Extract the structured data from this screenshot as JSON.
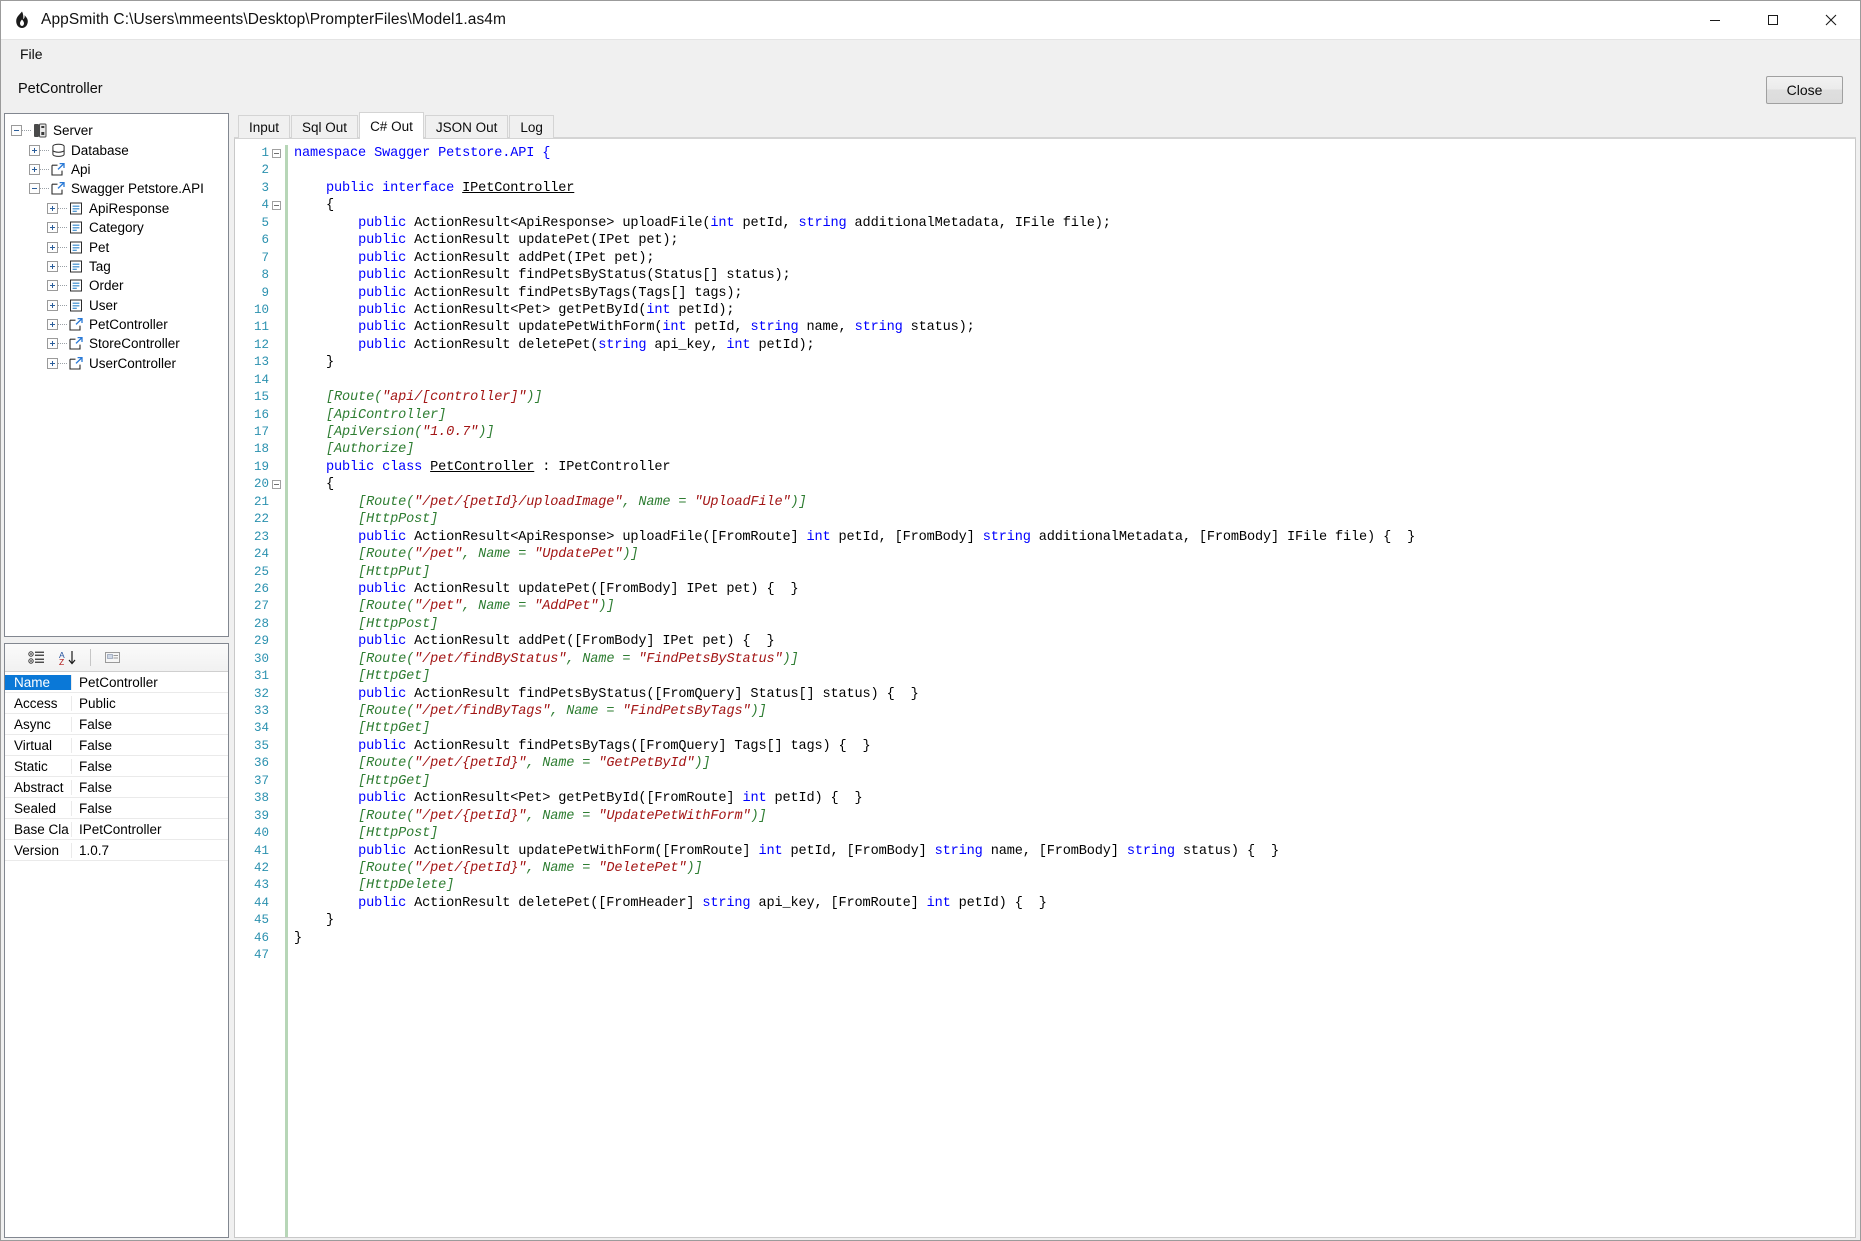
{
  "window": {
    "title": "AppSmith C:\\Users\\mmeents\\Desktop\\PrompterFiles\\Model1.as4m",
    "app_icon": "flame-icon",
    "minimize_label": "—",
    "maximize_label": "□",
    "close_label": "✕"
  },
  "menubar": {
    "items": [
      {
        "label": "File"
      }
    ]
  },
  "subheader": {
    "breadcrumb": "PetController",
    "close_button": "Close"
  },
  "tree": {
    "nodes": [
      {
        "label": "Server",
        "depth": 0,
        "expander": "minus",
        "icon": "server-icon"
      },
      {
        "label": "Database",
        "depth": 1,
        "expander": "plus",
        "icon": "database-icon"
      },
      {
        "label": "Api",
        "depth": 1,
        "expander": "plus",
        "icon": "api-icon"
      },
      {
        "label": "Swagger Petstore.API",
        "depth": 1,
        "expander": "minus",
        "icon": "api-icon"
      },
      {
        "label": "ApiResponse",
        "depth": 2,
        "expander": "plus",
        "icon": "class-icon"
      },
      {
        "label": "Category",
        "depth": 2,
        "expander": "plus",
        "icon": "class-icon"
      },
      {
        "label": "Pet",
        "depth": 2,
        "expander": "plus",
        "icon": "class-icon"
      },
      {
        "label": "Tag",
        "depth": 2,
        "expander": "plus",
        "icon": "class-icon"
      },
      {
        "label": "Order",
        "depth": 2,
        "expander": "plus",
        "icon": "class-icon"
      },
      {
        "label": "User",
        "depth": 2,
        "expander": "plus",
        "icon": "class-icon"
      },
      {
        "label": "PetController",
        "depth": 2,
        "expander": "plus",
        "icon": "api-icon"
      },
      {
        "label": "StoreController",
        "depth": 2,
        "expander": "plus",
        "icon": "api-icon"
      },
      {
        "label": "UserController",
        "depth": 2,
        "expander": "plus",
        "icon": "api-icon"
      }
    ]
  },
  "properties": {
    "toolbar": {
      "categorized_icon": "categorized-view-icon",
      "alphabetical_icon": "sort-alphabetical-icon",
      "property_pages_icon": "property-pages-icon"
    },
    "rows": [
      {
        "name": "Name",
        "value": "PetController",
        "selected": true
      },
      {
        "name": "Access",
        "value": "Public",
        "selected": false
      },
      {
        "name": "Async",
        "value": "False",
        "selected": false
      },
      {
        "name": "Virtual",
        "value": "False",
        "selected": false
      },
      {
        "name": "Static",
        "value": "False",
        "selected": false
      },
      {
        "name": "Abstract",
        "value": "False",
        "selected": false
      },
      {
        "name": "Sealed",
        "value": "False",
        "selected": false
      },
      {
        "name": "Base Cla",
        "value": "IPetController",
        "selected": false
      },
      {
        "name": "Version",
        "value": "1.0.7",
        "selected": false
      }
    ]
  },
  "editor": {
    "tabs": [
      {
        "label": "Input",
        "active": false
      },
      {
        "label": "Sql Out",
        "active": false
      },
      {
        "label": "C# Out",
        "active": true
      },
      {
        "label": "JSON Out",
        "active": false
      },
      {
        "label": "Log",
        "active": false
      }
    ],
    "line_count": 47,
    "fold_lines": [
      1,
      4,
      20
    ],
    "lines": [
      [
        {
          "t": "namespace Swagger Petstore.API {",
          "c": "kw"
        }
      ],
      [],
      [
        {
          "t": "    ",
          "c": "plain"
        },
        {
          "t": "public interface ",
          "c": "kw"
        },
        {
          "t": "IPetController",
          "c": "type-u"
        }
      ],
      [
        {
          "t": "    {",
          "c": "plain"
        }
      ],
      [
        {
          "t": "        ",
          "c": "plain"
        },
        {
          "t": "public",
          "c": "kw"
        },
        {
          "t": " ActionResult<ApiResponse> uploadFile(",
          "c": "plain"
        },
        {
          "t": "int",
          "c": "kw"
        },
        {
          "t": " petId, ",
          "c": "plain"
        },
        {
          "t": "string",
          "c": "kw"
        },
        {
          "t": " additionalMetadata, IFile file);",
          "c": "plain"
        }
      ],
      [
        {
          "t": "        ",
          "c": "plain"
        },
        {
          "t": "public",
          "c": "kw"
        },
        {
          "t": " ActionResult updatePet(IPet pet);",
          "c": "plain"
        }
      ],
      [
        {
          "t": "        ",
          "c": "plain"
        },
        {
          "t": "public",
          "c": "kw"
        },
        {
          "t": " ActionResult addPet(IPet pet);",
          "c": "plain"
        }
      ],
      [
        {
          "t": "        ",
          "c": "plain"
        },
        {
          "t": "public",
          "c": "kw"
        },
        {
          "t": " ActionResult findPetsByStatus(Status[] status);",
          "c": "plain"
        }
      ],
      [
        {
          "t": "        ",
          "c": "plain"
        },
        {
          "t": "public",
          "c": "kw"
        },
        {
          "t": " ActionResult findPetsByTags(Tags[] tags);",
          "c": "plain"
        }
      ],
      [
        {
          "t": "        ",
          "c": "plain"
        },
        {
          "t": "public",
          "c": "kw"
        },
        {
          "t": " ActionResult<Pet> getPetById(",
          "c": "plain"
        },
        {
          "t": "int",
          "c": "kw"
        },
        {
          "t": " petId);",
          "c": "plain"
        }
      ],
      [
        {
          "t": "        ",
          "c": "plain"
        },
        {
          "t": "public",
          "c": "kw"
        },
        {
          "t": " ActionResult updatePetWithForm(",
          "c": "plain"
        },
        {
          "t": "int",
          "c": "kw"
        },
        {
          "t": " petId, ",
          "c": "plain"
        },
        {
          "t": "string",
          "c": "kw"
        },
        {
          "t": " name, ",
          "c": "plain"
        },
        {
          "t": "string",
          "c": "kw"
        },
        {
          "t": " status);",
          "c": "plain"
        }
      ],
      [
        {
          "t": "        ",
          "c": "plain"
        },
        {
          "t": "public",
          "c": "kw"
        },
        {
          "t": " ActionResult deletePet(",
          "c": "plain"
        },
        {
          "t": "string",
          "c": "kw"
        },
        {
          "t": " api_key, ",
          "c": "plain"
        },
        {
          "t": "int",
          "c": "kw"
        },
        {
          "t": " petId);",
          "c": "plain"
        }
      ],
      [
        {
          "t": "    }",
          "c": "plain"
        }
      ],
      [],
      [
        {
          "t": "    ",
          "c": "plain"
        },
        {
          "t": "[Route(",
          "c": "attr"
        },
        {
          "t": "\"api/[controller]\"",
          "c": "str"
        },
        {
          "t": ")]",
          "c": "attr"
        }
      ],
      [
        {
          "t": "    ",
          "c": "plain"
        },
        {
          "t": "[ApiController]",
          "c": "attr"
        }
      ],
      [
        {
          "t": "    ",
          "c": "plain"
        },
        {
          "t": "[ApiVersion(",
          "c": "attr"
        },
        {
          "t": "\"1.0.7\"",
          "c": "str"
        },
        {
          "t": ")]",
          "c": "attr"
        }
      ],
      [
        {
          "t": "    ",
          "c": "plain"
        },
        {
          "t": "[Authorize]",
          "c": "attr"
        }
      ],
      [
        {
          "t": "    ",
          "c": "plain"
        },
        {
          "t": "public class ",
          "c": "kw"
        },
        {
          "t": "PetController",
          "c": "type-u"
        },
        {
          "t": " : IPetController",
          "c": "plain"
        }
      ],
      [
        {
          "t": "    {",
          "c": "plain"
        }
      ],
      [
        {
          "t": "        ",
          "c": "plain"
        },
        {
          "t": "[Route(",
          "c": "attr"
        },
        {
          "t": "\"/pet/{petId}/uploadImage\"",
          "c": "str"
        },
        {
          "t": ", Name = ",
          "c": "attr"
        },
        {
          "t": "\"UploadFile\"",
          "c": "str"
        },
        {
          "t": ")]",
          "c": "attr"
        }
      ],
      [
        {
          "t": "        ",
          "c": "plain"
        },
        {
          "t": "[HttpPost]",
          "c": "attr"
        }
      ],
      [
        {
          "t": "        ",
          "c": "plain"
        },
        {
          "t": "public",
          "c": "kw"
        },
        {
          "t": " ActionResult<ApiResponse> uploadFile([FromRoute] ",
          "c": "plain"
        },
        {
          "t": "int",
          "c": "kw"
        },
        {
          "t": " petId, [FromBody] ",
          "c": "plain"
        },
        {
          "t": "string",
          "c": "kw"
        },
        {
          "t": " additionalMetadata, [FromBody] IFile file) {  }",
          "c": "plain"
        }
      ],
      [
        {
          "t": "        ",
          "c": "plain"
        },
        {
          "t": "[Route(",
          "c": "attr"
        },
        {
          "t": "\"/pet\"",
          "c": "str"
        },
        {
          "t": ", Name = ",
          "c": "attr"
        },
        {
          "t": "\"UpdatePet\"",
          "c": "str"
        },
        {
          "t": ")]",
          "c": "attr"
        }
      ],
      [
        {
          "t": "        ",
          "c": "plain"
        },
        {
          "t": "[HttpPut]",
          "c": "attr"
        }
      ],
      [
        {
          "t": "        ",
          "c": "plain"
        },
        {
          "t": "public",
          "c": "kw"
        },
        {
          "t": " ActionResult updatePet([FromBody] IPet pet) {  }",
          "c": "plain"
        }
      ],
      [
        {
          "t": "        ",
          "c": "plain"
        },
        {
          "t": "[Route(",
          "c": "attr"
        },
        {
          "t": "\"/pet\"",
          "c": "str"
        },
        {
          "t": ", Name = ",
          "c": "attr"
        },
        {
          "t": "\"AddPet\"",
          "c": "str"
        },
        {
          "t": ")]",
          "c": "attr"
        }
      ],
      [
        {
          "t": "        ",
          "c": "plain"
        },
        {
          "t": "[HttpPost]",
          "c": "attr"
        }
      ],
      [
        {
          "t": "        ",
          "c": "plain"
        },
        {
          "t": "public",
          "c": "kw"
        },
        {
          "t": " ActionResult addPet([FromBody] IPet pet) {  }",
          "c": "plain"
        }
      ],
      [
        {
          "t": "        ",
          "c": "plain"
        },
        {
          "t": "[Route(",
          "c": "attr"
        },
        {
          "t": "\"/pet/findByStatus\"",
          "c": "str"
        },
        {
          "t": ", Name = ",
          "c": "attr"
        },
        {
          "t": "\"FindPetsByStatus\"",
          "c": "str"
        },
        {
          "t": ")]",
          "c": "attr"
        }
      ],
      [
        {
          "t": "        ",
          "c": "plain"
        },
        {
          "t": "[HttpGet]",
          "c": "attr"
        }
      ],
      [
        {
          "t": "        ",
          "c": "plain"
        },
        {
          "t": "public",
          "c": "kw"
        },
        {
          "t": " ActionResult findPetsByStatus([FromQuery] Status[] status) {  }",
          "c": "plain"
        }
      ],
      [
        {
          "t": "        ",
          "c": "plain"
        },
        {
          "t": "[Route(",
          "c": "attr"
        },
        {
          "t": "\"/pet/findByTags\"",
          "c": "str"
        },
        {
          "t": ", Name = ",
          "c": "attr"
        },
        {
          "t": "\"FindPetsByTags\"",
          "c": "str"
        },
        {
          "t": ")]",
          "c": "attr"
        }
      ],
      [
        {
          "t": "        ",
          "c": "plain"
        },
        {
          "t": "[HttpGet]",
          "c": "attr"
        }
      ],
      [
        {
          "t": "        ",
          "c": "plain"
        },
        {
          "t": "public",
          "c": "kw"
        },
        {
          "t": " ActionResult findPetsByTags([FromQuery] Tags[] tags) {  }",
          "c": "plain"
        }
      ],
      [
        {
          "t": "        ",
          "c": "plain"
        },
        {
          "t": "[Route(",
          "c": "attr"
        },
        {
          "t": "\"/pet/{petId}\"",
          "c": "str"
        },
        {
          "t": ", Name = ",
          "c": "attr"
        },
        {
          "t": "\"GetPetById\"",
          "c": "str"
        },
        {
          "t": ")]",
          "c": "attr"
        }
      ],
      [
        {
          "t": "        ",
          "c": "plain"
        },
        {
          "t": "[HttpGet]",
          "c": "attr"
        }
      ],
      [
        {
          "t": "        ",
          "c": "plain"
        },
        {
          "t": "public",
          "c": "kw"
        },
        {
          "t": " ActionResult<Pet> getPetById([FromRoute] ",
          "c": "plain"
        },
        {
          "t": "int",
          "c": "kw"
        },
        {
          "t": " petId) {  }",
          "c": "plain"
        }
      ],
      [
        {
          "t": "        ",
          "c": "plain"
        },
        {
          "t": "[Route(",
          "c": "attr"
        },
        {
          "t": "\"/pet/{petId}\"",
          "c": "str"
        },
        {
          "t": ", Name = ",
          "c": "attr"
        },
        {
          "t": "\"UpdatePetWithForm\"",
          "c": "str"
        },
        {
          "t": ")]",
          "c": "attr"
        }
      ],
      [
        {
          "t": "        ",
          "c": "plain"
        },
        {
          "t": "[HttpPost]",
          "c": "attr"
        }
      ],
      [
        {
          "t": "        ",
          "c": "plain"
        },
        {
          "t": "public",
          "c": "kw"
        },
        {
          "t": " ActionResult updatePetWithForm([FromRoute] ",
          "c": "plain"
        },
        {
          "t": "int",
          "c": "kw"
        },
        {
          "t": " petId, [FromBody] ",
          "c": "plain"
        },
        {
          "t": "string",
          "c": "kw"
        },
        {
          "t": " name, [FromBody] ",
          "c": "plain"
        },
        {
          "t": "string",
          "c": "kw"
        },
        {
          "t": " status) {  }",
          "c": "plain"
        }
      ],
      [
        {
          "t": "        ",
          "c": "plain"
        },
        {
          "t": "[Route(",
          "c": "attr"
        },
        {
          "t": "\"/pet/{petId}\"",
          "c": "str"
        },
        {
          "t": ", Name = ",
          "c": "attr"
        },
        {
          "t": "\"DeletePet\"",
          "c": "str"
        },
        {
          "t": ")]",
          "c": "attr"
        }
      ],
      [
        {
          "t": "        ",
          "c": "plain"
        },
        {
          "t": "[HttpDelete]",
          "c": "attr"
        }
      ],
      [
        {
          "t": "        ",
          "c": "plain"
        },
        {
          "t": "public",
          "c": "kw"
        },
        {
          "t": " ActionResult deletePet([FromHeader] ",
          "c": "plain"
        },
        {
          "t": "string",
          "c": "kw"
        },
        {
          "t": " api_key, [FromRoute] ",
          "c": "plain"
        },
        {
          "t": "int",
          "c": "kw"
        },
        {
          "t": " petId) {  }",
          "c": "plain"
        }
      ],
      [
        {
          "t": "    }",
          "c": "plain"
        }
      ],
      [
        {
          "t": "}",
          "c": "plain"
        }
      ],
      []
    ]
  },
  "colors": {
    "keyword": "#0000ff",
    "attribute": "#2e7d32",
    "string": "#a31515",
    "line_number": "#2b91af",
    "selection": "#0a78d7",
    "chrome": "#f0f0f0"
  }
}
